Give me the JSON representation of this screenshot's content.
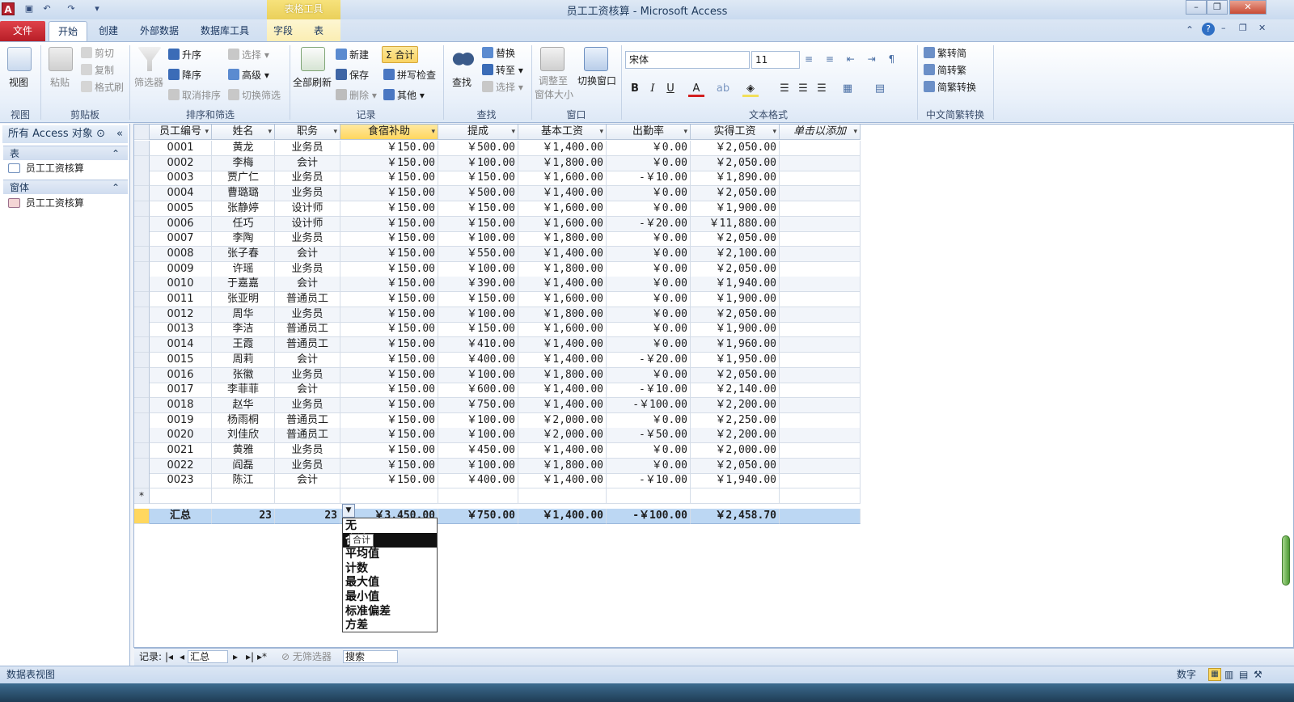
{
  "window": {
    "title": "员工工资核算 - Microsoft Access",
    "app_icon": "A",
    "context_tab_group": "表格工具"
  },
  "tabs": {
    "file": "文件",
    "home": "开始",
    "create": "创建",
    "external": "外部数据",
    "dbtools": "数据库工具",
    "fields": "字段",
    "table": "表"
  },
  "ribbon": {
    "view": {
      "btn": "视图",
      "group": "视图"
    },
    "clipboard": {
      "paste": "粘贴",
      "cut": "剪切",
      "copy": "复制",
      "format_painter": "格式刷",
      "group": "剪贴板"
    },
    "sort": {
      "filter": "筛选器",
      "asc": "升序",
      "desc": "降序",
      "clear_sort": "取消排序",
      "selection": "选择",
      "advanced": "高级",
      "toggle_filter": "切换筛选",
      "group": "排序和筛选"
    },
    "records": {
      "refresh_all": "全部刷新",
      "new": "新建",
      "save": "保存",
      "delete": "删除",
      "totals": "Σ 合计",
      "spelling": "拼写检查",
      "more": "其他",
      "group": "记录"
    },
    "find": {
      "find": "查找",
      "replace": "替换",
      "goto": "转至",
      "select": "选择",
      "group": "查找"
    },
    "window": {
      "size_to_fit_1": "调整至",
      "size_to_fit_2": "窗体大小",
      "switch_windows": "切换窗口",
      "group": "窗口"
    },
    "text": {
      "font": "宋体",
      "size": "11",
      "bold": "B",
      "italic": "I",
      "underline": "U",
      "color": "A",
      "group": "文本格式"
    },
    "chinese": {
      "t2s": "繁转简",
      "s2t": "简转繁",
      "convert": "简繁转换",
      "group": "中文简繁转换"
    }
  },
  "nav": {
    "header": "所有 Access 对象",
    "tables_section": "表",
    "table_item": "员工工资核算",
    "forms_section": "窗体",
    "form_item": "员工工资核算"
  },
  "sheet": {
    "columns": [
      "员工编号",
      "姓名",
      "职务",
      "食宿补助",
      "提成",
      "基本工资",
      "出勤率",
      "实得工资",
      "单击以添加"
    ],
    "rows": [
      [
        "0001",
        "黄龙",
        "业务员",
        "￥150.00",
        "￥500.00",
        "￥1,400.00",
        "￥0.00",
        "￥2,050.00"
      ],
      [
        "0002",
        "李梅",
        "会计",
        "￥150.00",
        "￥100.00",
        "￥1,800.00",
        "￥0.00",
        "￥2,050.00"
      ],
      [
        "0003",
        "贾广仁",
        "业务员",
        "￥150.00",
        "￥150.00",
        "￥1,600.00",
        "-￥10.00",
        "￥1,890.00"
      ],
      [
        "0004",
        "曹璐璐",
        "业务员",
        "￥150.00",
        "￥500.00",
        "￥1,400.00",
        "￥0.00",
        "￥2,050.00"
      ],
      [
        "0005",
        "张静婷",
        "设计师",
        "￥150.00",
        "￥150.00",
        "￥1,600.00",
        "￥0.00",
        "￥1,900.00"
      ],
      [
        "0006",
        "任巧",
        "设计师",
        "￥150.00",
        "￥150.00",
        "￥1,600.00",
        "-￥20.00",
        "￥11,880.00"
      ],
      [
        "0007",
        "李陶",
        "业务员",
        "￥150.00",
        "￥100.00",
        "￥1,800.00",
        "￥0.00",
        "￥2,050.00"
      ],
      [
        "0008",
        "张子春",
        "会计",
        "￥150.00",
        "￥550.00",
        "￥1,400.00",
        "￥0.00",
        "￥2,100.00"
      ],
      [
        "0009",
        "许瑶",
        "业务员",
        "￥150.00",
        "￥100.00",
        "￥1,800.00",
        "￥0.00",
        "￥2,050.00"
      ],
      [
        "0010",
        "于嘉嘉",
        "会计",
        "￥150.00",
        "￥390.00",
        "￥1,400.00",
        "￥0.00",
        "￥1,940.00"
      ],
      [
        "0011",
        "张亚明",
        "普通员工",
        "￥150.00",
        "￥150.00",
        "￥1,600.00",
        "￥0.00",
        "￥1,900.00"
      ],
      [
        "0012",
        "周华",
        "业务员",
        "￥150.00",
        "￥100.00",
        "￥1,800.00",
        "￥0.00",
        "￥2,050.00"
      ],
      [
        "0013",
        "李洁",
        "普通员工",
        "￥150.00",
        "￥150.00",
        "￥1,600.00",
        "￥0.00",
        "￥1,900.00"
      ],
      [
        "0014",
        "王霞",
        "普通员工",
        "￥150.00",
        "￥410.00",
        "￥1,400.00",
        "￥0.00",
        "￥1,960.00"
      ],
      [
        "0015",
        "周莉",
        "会计",
        "￥150.00",
        "￥400.00",
        "￥1,400.00",
        "-￥20.00",
        "￥1,950.00"
      ],
      [
        "0016",
        "张徽",
        "业务员",
        "￥150.00",
        "￥100.00",
        "￥1,800.00",
        "￥0.00",
        "￥2,050.00"
      ],
      [
        "0017",
        "李菲菲",
        "会计",
        "￥150.00",
        "￥600.00",
        "￥1,400.00",
        "-￥10.00",
        "￥2,140.00"
      ],
      [
        "0018",
        "赵华",
        "业务员",
        "￥150.00",
        "￥750.00",
        "￥1,400.00",
        "-￥100.00",
        "￥2,200.00"
      ],
      [
        "0019",
        "杨雨桐",
        "普通员工",
        "￥150.00",
        "￥100.00",
        "￥2,000.00",
        "￥0.00",
        "￥2,250.00"
      ],
      [
        "0020",
        "刘佳欣",
        "普通员工",
        "￥150.00",
        "￥100.00",
        "￥2,000.00",
        "-￥50.00",
        "￥2,200.00"
      ],
      [
        "0021",
        "黄雅",
        "业务员",
        "￥150.00",
        "￥450.00",
        "￥1,400.00",
        "￥0.00",
        "￥2,000.00"
      ],
      [
        "0022",
        "阎磊",
        "业务员",
        "￥150.00",
        "￥100.00",
        "￥1,800.00",
        "￥0.00",
        "￥2,050.00"
      ],
      [
        "0023",
        "陈江",
        "会计",
        "￥150.00",
        "￥400.00",
        "￥1,400.00",
        "-￥10.00",
        "￥1,940.00"
      ]
    ],
    "new_row_marker": "*",
    "totals": [
      "汇总",
      "23",
      "23",
      "￥3,450.00",
      "￥750.00",
      "￥1,400.00",
      "-￥100.00",
      "￥2,458.70"
    ]
  },
  "dropdown": {
    "items": [
      "无",
      "合计",
      "平均值",
      "计数",
      "最大值",
      "最小值",
      "标准偏差",
      "方差"
    ],
    "highlighted_index": 1,
    "tooltip": "合计"
  },
  "record_nav": {
    "label": "记录:",
    "current": "汇总",
    "filter": "无筛选器",
    "search": "搜索"
  },
  "status": {
    "left": "数据表视图",
    "right": "数字"
  }
}
